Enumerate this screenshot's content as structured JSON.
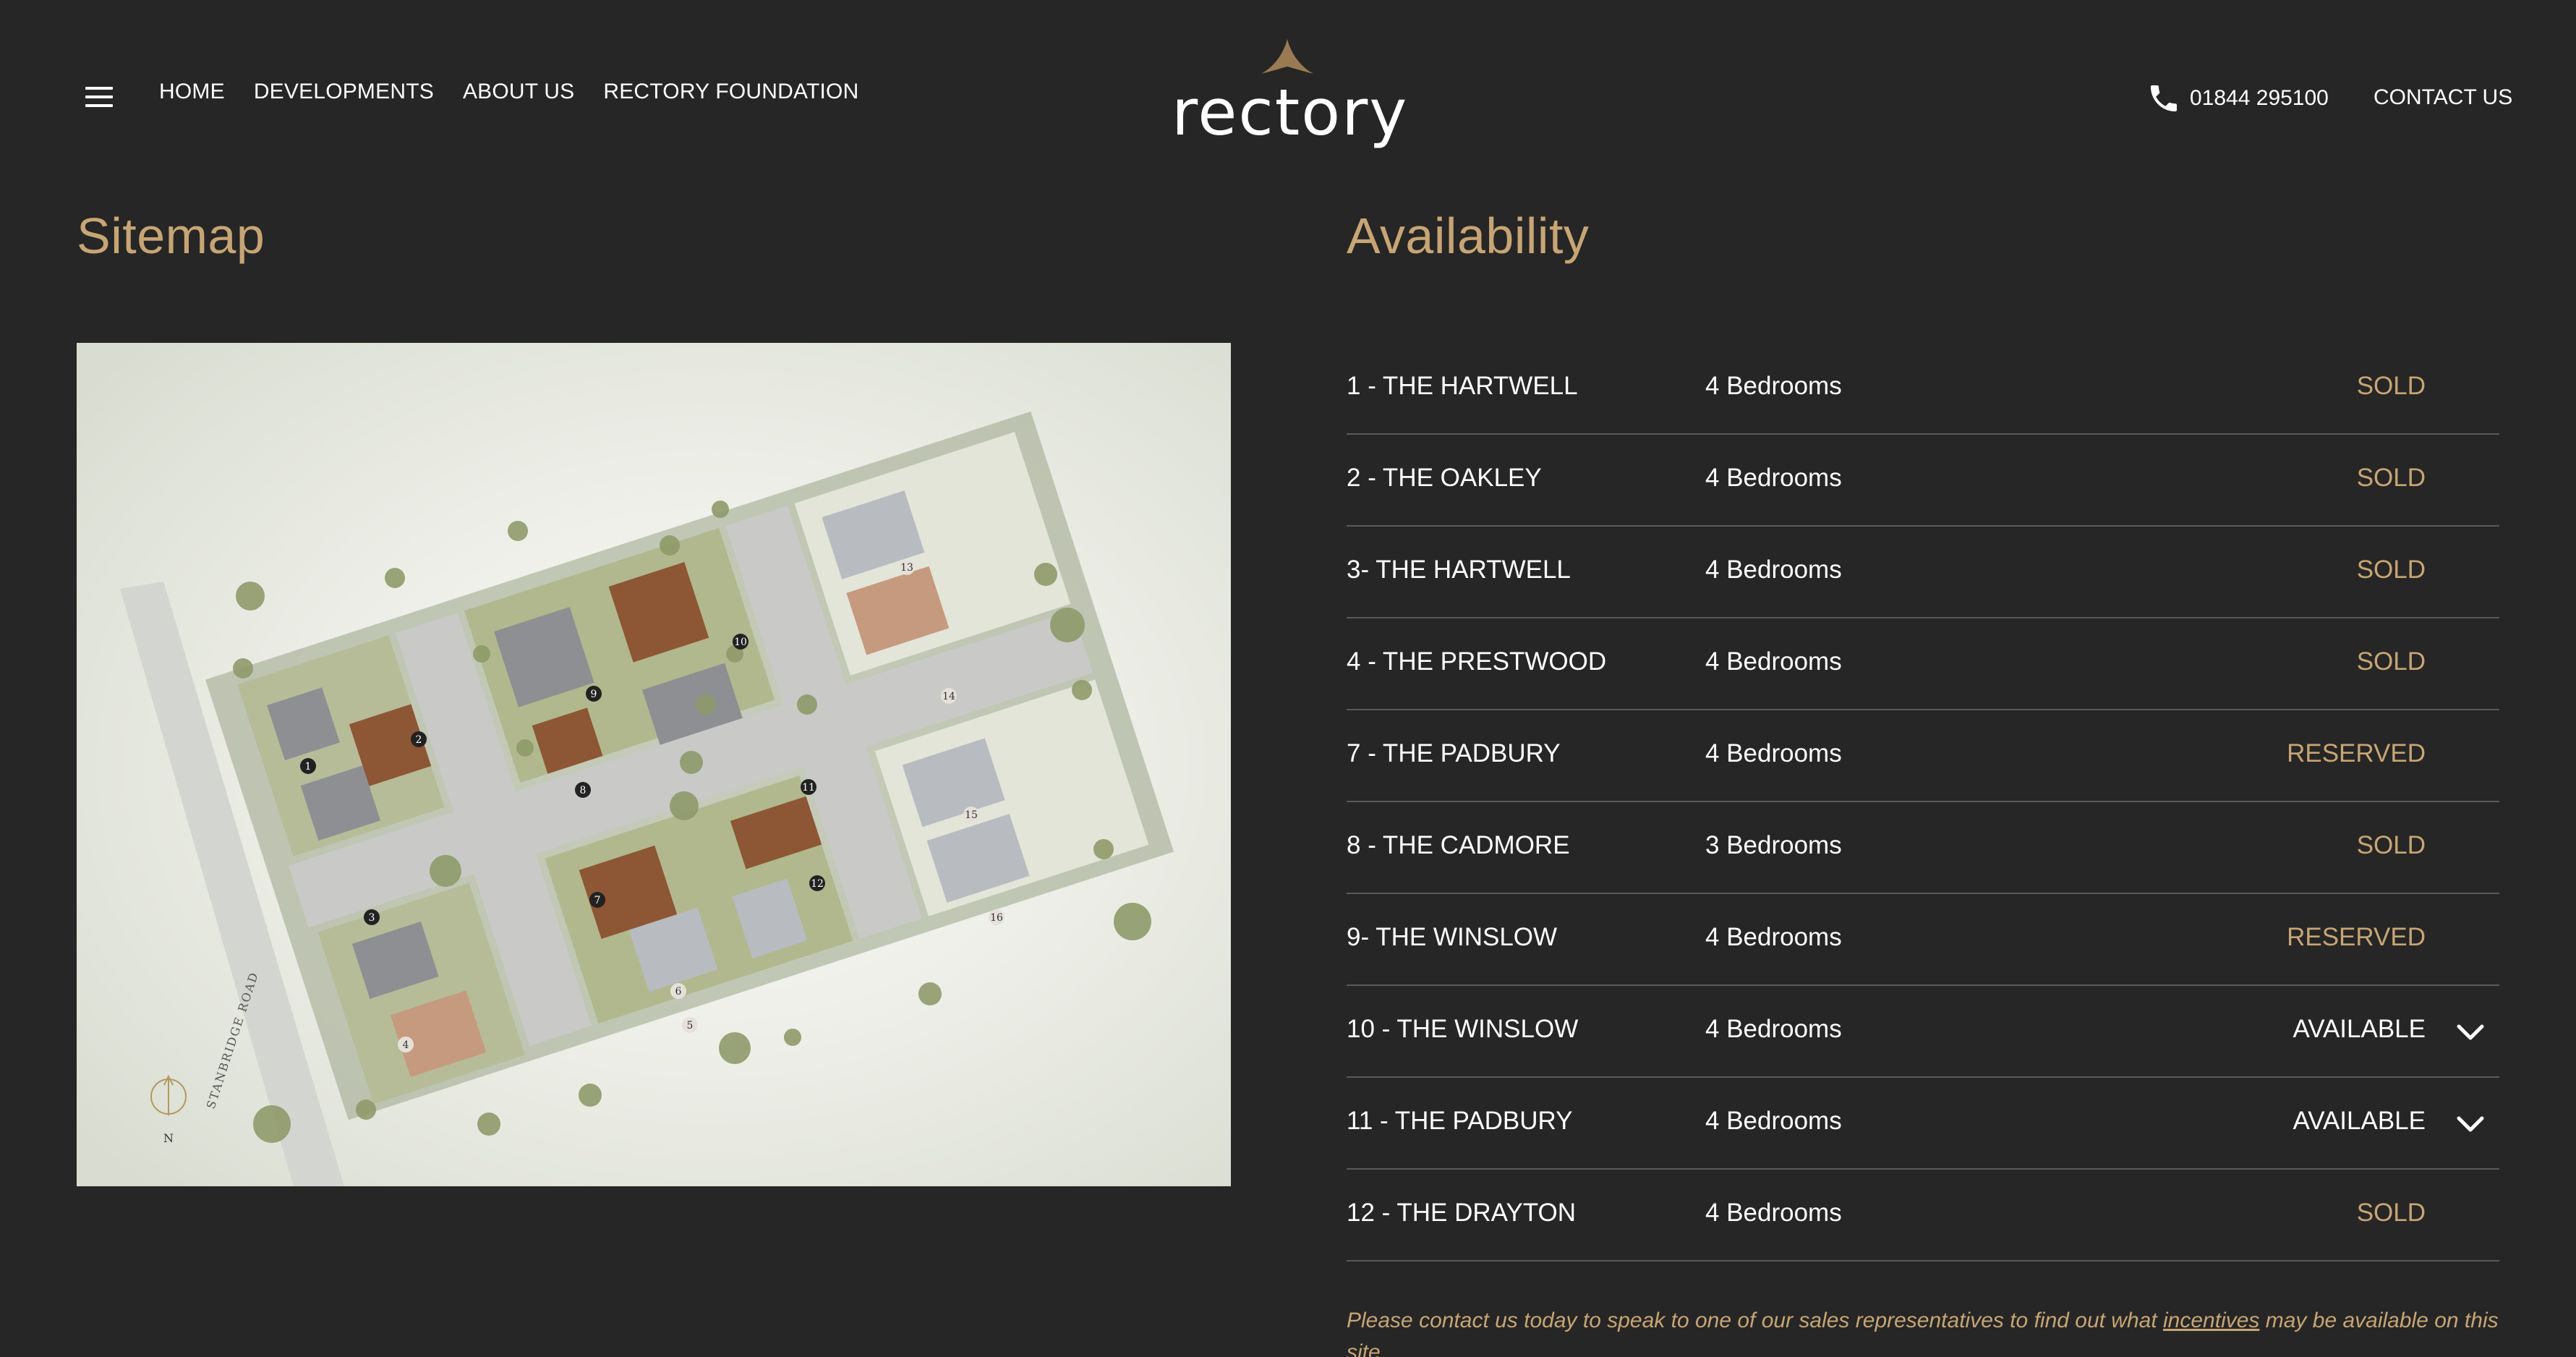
{
  "nav": {
    "items": [
      "HOME",
      "DEVELOPMENTS",
      "ABOUT US",
      "RECTORY FOUNDATION"
    ]
  },
  "brand": {
    "logo_text": "rectory"
  },
  "contact": {
    "phone": "01844 295100",
    "contact_label": "CONTACT US"
  },
  "sitemap": {
    "title": "Sitemap",
    "road_label": "STANBRIDGE ROAD",
    "compass_label": "N",
    "plot_numbers": [
      "1",
      "2",
      "3",
      "4",
      "5",
      "6",
      "7",
      "8",
      "9",
      "10",
      "11",
      "12",
      "13",
      "14",
      "15",
      "16"
    ]
  },
  "availability": {
    "title": "Availability",
    "rows": [
      {
        "plot": "1 - THE HARTWELL",
        "bedrooms": "4 Bedrooms",
        "status": "SOLD"
      },
      {
        "plot": "2 - THE OAKLEY",
        "bedrooms": "4 Bedrooms",
        "status": "SOLD"
      },
      {
        "plot": "3- THE HARTWELL",
        "bedrooms": "4 Bedrooms",
        "status": "SOLD"
      },
      {
        "plot": "4 - THE PRESTWOOD",
        "bedrooms": "4 Bedrooms",
        "status": "SOLD"
      },
      {
        "plot": "7 - THE PADBURY",
        "bedrooms": "4 Bedrooms",
        "status": "RESERVED"
      },
      {
        "plot": "8 - THE CADMORE",
        "bedrooms": "3 Bedrooms",
        "status": "SOLD"
      },
      {
        "plot": "9- THE WINSLOW",
        "bedrooms": "4 Bedrooms",
        "status": "RESERVED"
      },
      {
        "plot": "10 - THE WINSLOW",
        "bedrooms": "4 Bedrooms",
        "status": "AVAILABLE"
      },
      {
        "plot": "11 - THE PADBURY",
        "bedrooms": "4 Bedrooms",
        "status": "AVAILABLE"
      },
      {
        "plot": "12 - THE DRAYTON",
        "bedrooms": "4 Bedrooms",
        "status": "SOLD"
      }
    ],
    "note_before": "Please contact us today to speak to one of our sales representatives to find out what ",
    "note_link": "incentives",
    "note_after": " may be available on this site."
  },
  "colors": {
    "background": "#262626",
    "accent_gold": "#c7a574",
    "text": "#ffffff",
    "divider": "#5a5a5a"
  },
  "icons": [
    "menu-icon",
    "phone-icon",
    "chevron-down-icon",
    "compass-icon"
  ]
}
